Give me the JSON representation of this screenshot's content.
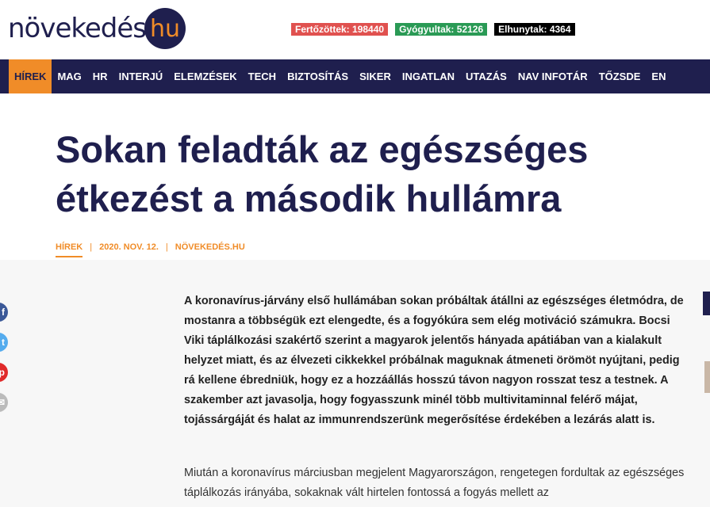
{
  "brand": {
    "logo_main": "növekedés",
    "logo_hu": "hu"
  },
  "stats": [
    {
      "label": "Fertőzöttek:",
      "value": "198440",
      "color": "#e0514f"
    },
    {
      "label": "Gyógyultak:",
      "value": "52126",
      "color": "#2a9a55"
    },
    {
      "label": "Elhunytak:",
      "value": "4364",
      "color": "#000000"
    }
  ],
  "nav": {
    "items": [
      "HÍREK",
      "MAG",
      "HR",
      "INTERJÚ",
      "ELEMZÉSEK",
      "TECH",
      "BIZTOSÍTÁS",
      "SIKER",
      "INGATLAN",
      "UTAZÁS",
      "NAV INFOTÁR",
      "TŐZSDE",
      "EN"
    ],
    "active": "HÍREK"
  },
  "article": {
    "title_line1": "Sokan feladták az egészséges",
    "title_line2": "étkezést a második hullámra",
    "category": "HÍREK",
    "date": "2020. NOV. 12.",
    "source": "NÖVEKEDÉS.HU",
    "lead": "A koronavírus-járvány első hullámában sokan próbáltak átállni az egészséges életmódra, de mostanra a többségük ezt elengedte, és a fogyókúra sem elég motiváció számukra. Bocsi Viki táplálkozási szakértő szerint a magyarok jelentős hányada apátiában van a kialakult helyzet miatt, és az élvezeti cikkekkel próbálnak maguknak átmeneti örömöt nyújtani, pedig rá kellene ébredniük, hogy ez a hozzáállás hosszú távon nagyon rosszat tesz a testnek. A szakember azt javasolja, hogy fogyasszunk minél több multivitaminnal felérő májat, tojássárgáját és halat az immunrendszerünk megerősítése érdekében a lezárás alatt is.",
    "body": "Miután a koronavírus márciusban megjelent Magyarországon, rengetegen fordultak az egészséges táplálkozás irányába, sokaknak vált hirtelen fontossá a fogyás mellett az"
  },
  "social": {
    "icons": [
      "facebook-icon",
      "twitter-icon",
      "pinterest-icon",
      "email-icon"
    ],
    "glyphs": [
      "f",
      "t",
      "p",
      "✉"
    ]
  },
  "colors": {
    "navy": "#1f1f4e",
    "orange": "#f08c28"
  }
}
